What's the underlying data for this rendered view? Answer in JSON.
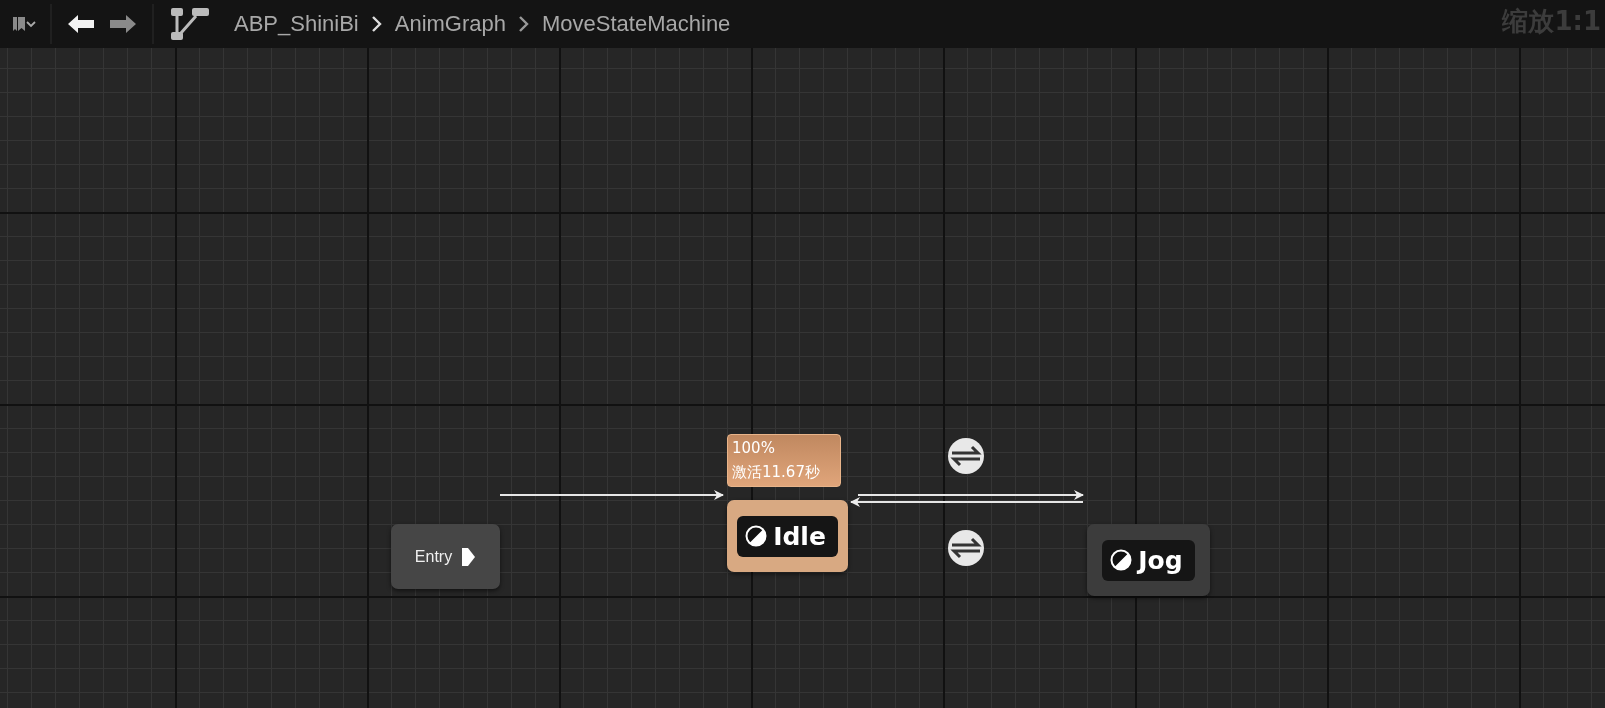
{
  "toolbar": {
    "breadcrumbs": [
      {
        "label": "ABP_ShiniBi"
      },
      {
        "label": "AnimGraph"
      },
      {
        "label": "MoveStateMachine"
      }
    ],
    "zoom_label": "缩放1:1"
  },
  "graph": {
    "nodes": [
      {
        "kind": "entry",
        "label": "Entry"
      },
      {
        "kind": "state",
        "label": "Idle",
        "active": true,
        "weight": "100%",
        "active_time": "激活11.67秒"
      },
      {
        "kind": "state",
        "label": "Jog",
        "active": false
      }
    ]
  }
}
